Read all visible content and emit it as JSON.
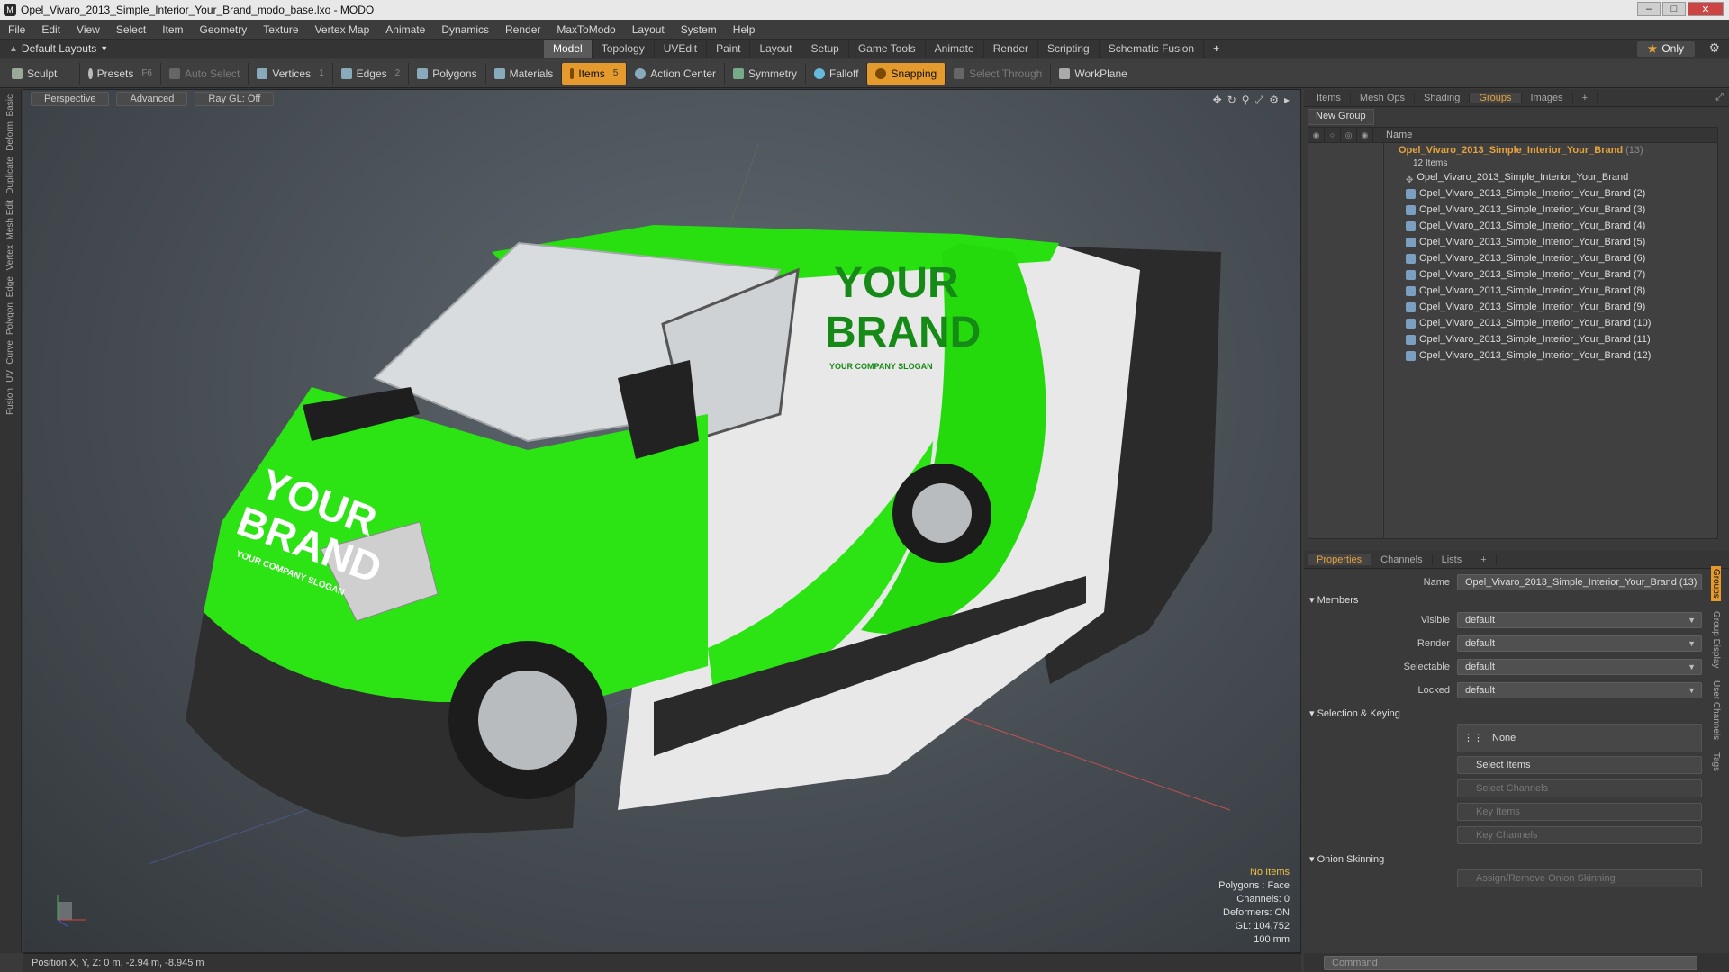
{
  "window": {
    "title": "Opel_Vivaro_2013_Simple_Interior_Your_Brand_modo_base.lxo - MODO",
    "min": "–",
    "max": "□",
    "close": "✕"
  },
  "menu": [
    "File",
    "Edit",
    "View",
    "Select",
    "Item",
    "Geometry",
    "Texture",
    "Vertex Map",
    "Animate",
    "Dynamics",
    "Render",
    "MaxToModo",
    "Layout",
    "System",
    "Help"
  ],
  "layout_selector": "Default Layouts",
  "mode_tabs": [
    {
      "label": "Model",
      "active": true
    },
    {
      "label": "Topology"
    },
    {
      "label": "UVEdit"
    },
    {
      "label": "Paint"
    },
    {
      "label": "Layout"
    },
    {
      "label": "Setup"
    },
    {
      "label": "Game Tools"
    },
    {
      "label": "Animate"
    },
    {
      "label": "Render"
    },
    {
      "label": "Scripting"
    },
    {
      "label": "Schematic Fusion"
    }
  ],
  "plus": "+",
  "only_label": "Only",
  "toolbar": {
    "sculpt": "Sculpt",
    "presets": "Presets",
    "presets_key": "F6",
    "auto_select": "Auto Select",
    "vertices": "Vertices",
    "vertices_key": "1",
    "edges": "Edges",
    "edges_key": "2",
    "polygons": "Polygons",
    "materials": "Materials",
    "items": "Items",
    "items_key": "5",
    "action_center": "Action Center",
    "symmetry": "Symmetry",
    "falloff": "Falloff",
    "snapping": "Snapping",
    "select_through": "Select Through",
    "workplane": "WorkPlane"
  },
  "left_tabs": [
    "Basic",
    "Deform",
    "Duplicate",
    "Mesh Edit",
    "Vertex",
    "Edge",
    "Polygon",
    "Curve",
    "UV",
    "Fusion"
  ],
  "viewport": {
    "view": "Perspective",
    "shading": "Advanced",
    "raygl": "Ray GL: Off",
    "brand_line1": "YOUR",
    "brand_line2": "BRAND",
    "slogan": "YOUR COMPANY SLOGAN"
  },
  "stats": {
    "items": "No Items",
    "polygons": "Polygons : Face",
    "channels": "Channels: 0",
    "deformers": "Deformers: ON",
    "gl": "GL: 104,752",
    "scale": "100 mm"
  },
  "status": "Position X, Y, Z:  0 m, -2.94 m, -8.945 m",
  "panel_tabs": [
    {
      "label": "Items"
    },
    {
      "label": "Mesh Ops"
    },
    {
      "label": "Shading"
    },
    {
      "label": "Groups",
      "active": true
    },
    {
      "label": "Images"
    }
  ],
  "new_group": "New Group",
  "groups": {
    "name_header": "Name",
    "group_name": "Opel_Vivaro_2013_Simple_Interior_Your_Brand",
    "group_count": "(13)",
    "sub": "12 Items",
    "items": [
      "Opel_Vivaro_2013_Simple_Interior_Your_Brand",
      "Opel_Vivaro_2013_Simple_Interior_Your_Brand (2)",
      "Opel_Vivaro_2013_Simple_Interior_Your_Brand (3)",
      "Opel_Vivaro_2013_Simple_Interior_Your_Brand (4)",
      "Opel_Vivaro_2013_Simple_Interior_Your_Brand (5)",
      "Opel_Vivaro_2013_Simple_Interior_Your_Brand (6)",
      "Opel_Vivaro_2013_Simple_Interior_Your_Brand (7)",
      "Opel_Vivaro_2013_Simple_Interior_Your_Brand (8)",
      "Opel_Vivaro_2013_Simple_Interior_Your_Brand (9)",
      "Opel_Vivaro_2013_Simple_Interior_Your_Brand (10)",
      "Opel_Vivaro_2013_Simple_Interior_Your_Brand (11)",
      "Opel_Vivaro_2013_Simple_Interior_Your_Brand (12)"
    ]
  },
  "prop_tabs": [
    {
      "label": "Properties",
      "active": true
    },
    {
      "label": "Channels"
    },
    {
      "label": "Lists"
    }
  ],
  "props": {
    "name_label": "Name",
    "name_value": "Opel_Vivaro_2013_Simple_Interior_Your_Brand (13)",
    "members": "Members",
    "visible_label": "Visible",
    "visible": "default",
    "render_label": "Render",
    "render": "default",
    "selectable_label": "Selectable",
    "selectable": "default",
    "locked_label": "Locked",
    "locked": "default",
    "sel_keying": "Selection & Keying",
    "none": "None",
    "select_items": "Select Items",
    "select_channels": "Select Channels",
    "key_items": "Key Items",
    "key_channels": "Key Channels",
    "onion": "Onion Skinning",
    "assign_onion": "Assign/Remove Onion Skinning"
  },
  "side_tabs": [
    "Groups",
    "Group Display",
    "User Channels",
    "Tags"
  ],
  "command_placeholder": "Command",
  "colors": {
    "accent": "#e49a2c",
    "brand_green": "#22e00a",
    "group_orange": "#e6a23c"
  }
}
